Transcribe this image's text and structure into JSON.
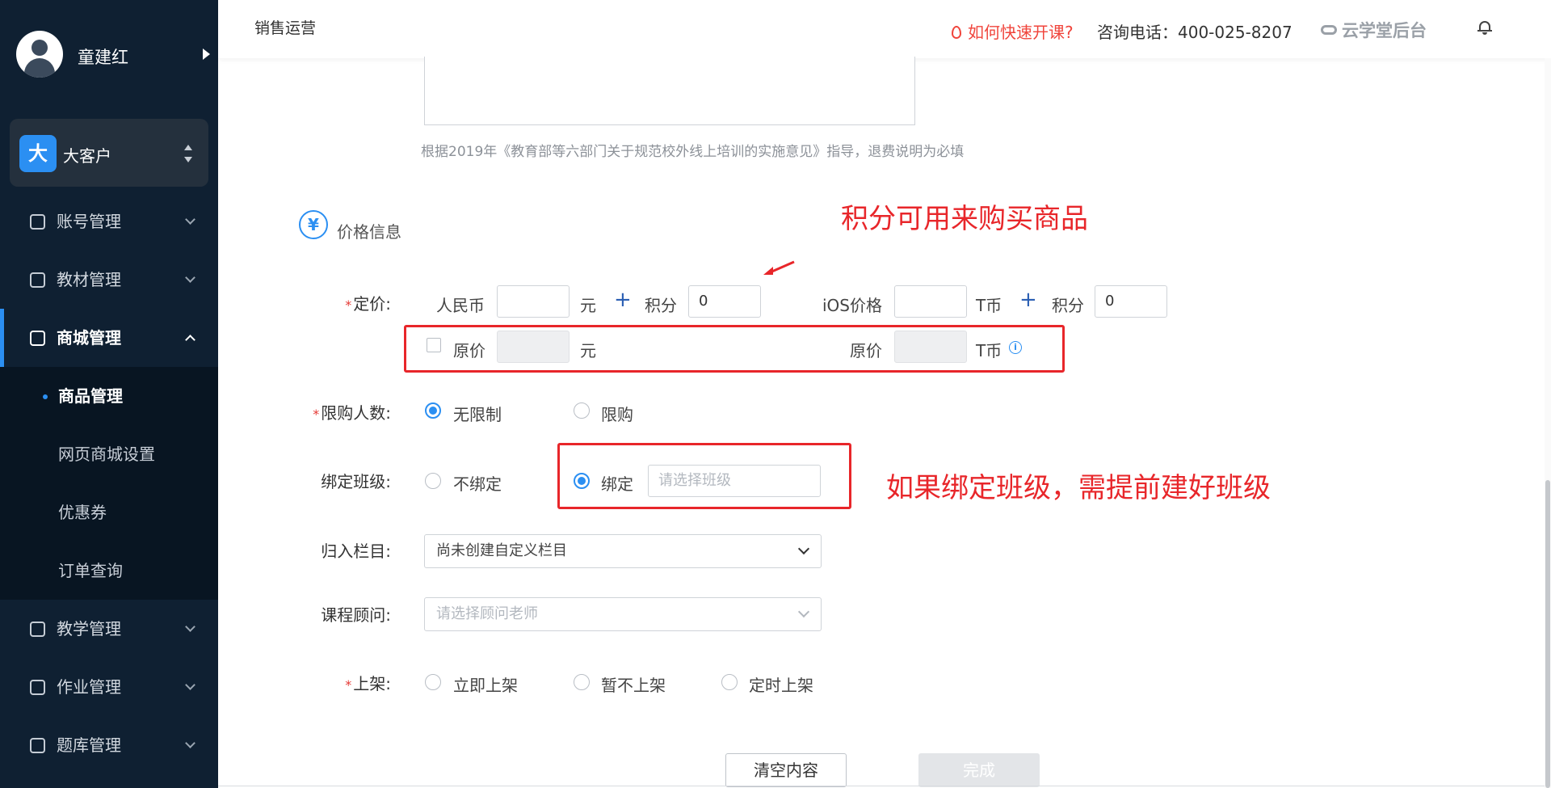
{
  "header": {
    "breadcrumb": "销售运营",
    "quick_start": "如何快速开课?",
    "phone": "咨询电话：400-025-8207",
    "brand": "云学堂后台"
  },
  "sidebar": {
    "user_name": "童建红",
    "org_badge": "大",
    "org_name": "大客户",
    "menu": [
      {
        "label": "账号管理",
        "icon": "user-icon"
      },
      {
        "label": "教材管理",
        "icon": "book-icon"
      },
      {
        "label": "商城管理",
        "icon": "shop-icon",
        "active": true
      },
      {
        "label": "教学管理",
        "icon": "notebook-icon"
      },
      {
        "label": "作业管理",
        "icon": "homework-icon"
      },
      {
        "label": "题库管理",
        "icon": "question-bank-icon"
      }
    ],
    "submenu": [
      {
        "label": "商品管理",
        "current": true
      },
      {
        "label": "网页商城设置"
      },
      {
        "label": "优惠券"
      },
      {
        "label": "订单查询"
      }
    ]
  },
  "form": {
    "hint": "根据2019年《教育部等六部门关于规范校外线上培训的实施意见》指导，退费说明为必填",
    "section_icon": "¥",
    "section_title": "价格信息",
    "price": {
      "label": "定价:",
      "rmb_label": "人民币",
      "rmb_value": "",
      "yuan_unit": "元",
      "points_label": "积分",
      "points_value": "0",
      "ios_label": "iOS价格",
      "ios_value": "",
      "tcoin_unit": "T币",
      "ios_points_label": "积分",
      "ios_points_value": "0",
      "plus": "+"
    },
    "original_price": {
      "label": "原价",
      "unit": "元",
      "ios_label": "原价",
      "ios_unit": "T币",
      "info": "i"
    },
    "limit": {
      "label": "限购人数:",
      "options": [
        "无限制",
        "限购"
      ],
      "selected": "无限制"
    },
    "bind_class": {
      "label": "绑定班级:",
      "options": [
        "不绑定",
        "绑定"
      ],
      "selected": "绑定",
      "placeholder": "请选择班级"
    },
    "column": {
      "label": "归入栏目:",
      "value": "尚未创建自定义栏目"
    },
    "advisor": {
      "label": "课程顾问:",
      "placeholder": "请选择顾问老师"
    },
    "publish": {
      "label": "上架:",
      "options": [
        "立即上架",
        "暂不上架",
        "定时上架"
      ]
    },
    "required_mark": "*"
  },
  "annotations": {
    "points_note": "积分可用来购买商品",
    "bind_note": "如果绑定班级，需提前建好班级",
    "color": "#e8262a"
  },
  "buttons": {
    "clear": "清空内容",
    "done": "完成"
  },
  "colors": {
    "accent": "#2b8ff2",
    "sidebar_bg": "#0f2032",
    "required": "#e53935"
  }
}
